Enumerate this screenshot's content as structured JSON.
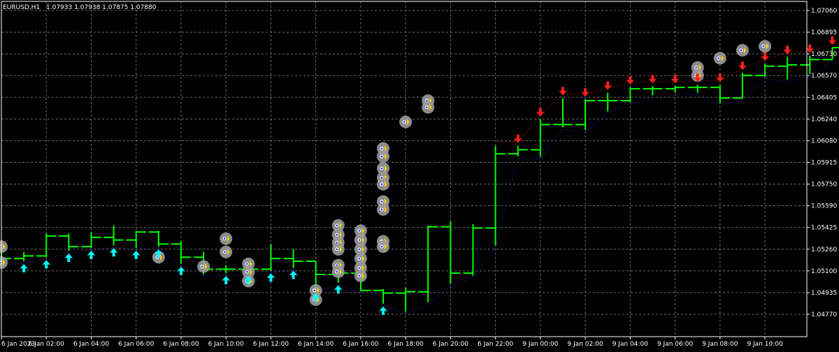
{
  "header": {
    "symbol_tf": "EURUSD,H1",
    "ohlc": "1.07933 1.07938 1.07875 1.07880"
  },
  "colors": {
    "background": "#000000",
    "grid": "#6d6d6d",
    "axis": "#ffffff",
    "bar": "#00ff00",
    "up_arrow": "#00ffff",
    "down_arrow": "#ff2020",
    "marker_circle": "#9a9a9a",
    "dot_blue": "#2233ff",
    "dot_red": "#ff2020"
  },
  "chart_data": {
    "type": "ohlc",
    "title": "EURUSD,H1  1.07933 1.07938 1.07875 1.07880",
    "ylim": [
      1.0477,
      1.0706
    ],
    "y_ticks": [
      "1.07060",
      "1.06895",
      "1.06730",
      "1.06570",
      "1.06405",
      "1.06240",
      "1.06080",
      "1.05915",
      "1.05750",
      "1.05590",
      "1.05425",
      "1.05260",
      "1.05100",
      "1.04935",
      "1.04770"
    ],
    "x_labels": [
      "6 Jan 2023",
      "6 Jan 02:00",
      "6 Jan 04:00",
      "6 Jan 06:00",
      "6 Jan 08:00",
      "6 Jan 10:00",
      "6 Jan 12:00",
      "6 Jan 14:00",
      "6 Jan 16:00",
      "6 Jan 18:00",
      "6 Jan 20:00",
      "6 Jan 22:00",
      "9 Jan 00:00",
      "9 Jan 02:00",
      "9 Jan 04:00",
      "9 Jan 06:00",
      "9 Jan 08:00",
      "9 Jan 10:00"
    ],
    "bars": [
      {
        "o": 1.0519,
        "h": 1.0526,
        "l": 1.0516,
        "c": 1.0519
      },
      {
        "o": 1.0519,
        "h": 1.0524,
        "l": 1.0517,
        "c": 1.0521
      },
      {
        "o": 1.0521,
        "h": 1.0538,
        "l": 1.052,
        "c": 1.0536
      },
      {
        "o": 1.0536,
        "h": 1.0538,
        "l": 1.0525,
        "c": 1.0528
      },
      {
        "o": 1.0528,
        "h": 1.0539,
        "l": 1.0527,
        "c": 1.0535
      },
      {
        "o": 1.0535,
        "h": 1.0544,
        "l": 1.0529,
        "c": 1.0533
      },
      {
        "o": 1.0533,
        "h": 1.054,
        "l": 1.0527,
        "c": 1.0539
      },
      {
        "o": 1.0539,
        "h": 1.054,
        "l": 1.0528,
        "c": 1.053
      },
      {
        "o": 1.053,
        "h": 1.0532,
        "l": 1.0515,
        "c": 1.052
      },
      {
        "o": 1.052,
        "h": 1.0524,
        "l": 1.0507,
        "c": 1.0511
      },
      {
        "o": 1.0511,
        "h": 1.0514,
        "l": 1.0508,
        "c": 1.0511
      },
      {
        "o": 1.0511,
        "h": 1.0514,
        "l": 1.0508,
        "c": 1.0511
      },
      {
        "o": 1.0511,
        "h": 1.053,
        "l": 1.051,
        "c": 1.0519
      },
      {
        "o": 1.0519,
        "h": 1.0526,
        "l": 1.0512,
        "c": 1.0517
      },
      {
        "o": 1.0517,
        "h": 1.0517,
        "l": 1.0495,
        "c": 1.0507
      },
      {
        "o": 1.0507,
        "h": 1.0507,
        "l": 1.0501,
        "c": 1.0508
      },
      {
        "o": 1.0508,
        "h": 1.0512,
        "l": 1.0495,
        "c": 1.0495
      },
      {
        "o": 1.0495,
        "h": 1.0496,
        "l": 1.0485,
        "c": 1.0493
      },
      {
        "o": 1.0493,
        "h": 1.0497,
        "l": 1.0479,
        "c": 1.0494
      },
      {
        "o": 1.0494,
        "h": 1.0544,
        "l": 1.0486,
        "c": 1.0543
      },
      {
        "o": 1.0543,
        "h": 1.0547,
        "l": 1.05,
        "c": 1.0508
      },
      {
        "o": 1.0508,
        "h": 1.0545,
        "l": 1.0506,
        "c": 1.0542
      },
      {
        "o": 1.0542,
        "h": 1.0604,
        "l": 1.0529,
        "c": 1.0598
      },
      {
        "o": 1.0598,
        "h": 1.0604,
        "l": 1.0596,
        "c": 1.0601
      },
      {
        "o": 1.0601,
        "h": 1.0624,
        "l": 1.0596,
        "c": 1.062
      },
      {
        "o": 1.062,
        "h": 1.064,
        "l": 1.0618,
        "c": 1.062
      },
      {
        "o": 1.062,
        "h": 1.0639,
        "l": 1.0616,
        "c": 1.0638
      },
      {
        "o": 1.0638,
        "h": 1.0644,
        "l": 1.063,
        "c": 1.0638
      },
      {
        "o": 1.0638,
        "h": 1.0648,
        "l": 1.0637,
        "c": 1.0647
      },
      {
        "o": 1.0647,
        "h": 1.0649,
        "l": 1.0642,
        "c": 1.0647
      },
      {
        "o": 1.0647,
        "h": 1.0649,
        "l": 1.0644,
        "c": 1.0648
      },
      {
        "o": 1.0648,
        "h": 1.065,
        "l": 1.0644,
        "c": 1.0648
      },
      {
        "o": 1.0648,
        "h": 1.065,
        "l": 1.0636,
        "c": 1.064
      },
      {
        "o": 1.064,
        "h": 1.0659,
        "l": 1.064,
        "c": 1.0657
      },
      {
        "o": 1.0657,
        "h": 1.0666,
        "l": 1.0656,
        "c": 1.0664
      },
      {
        "o": 1.0664,
        "h": 1.0671,
        "l": 1.0654,
        "c": 1.0665
      },
      {
        "o": 1.0665,
        "h": 1.0672,
        "l": 1.0658,
        "c": 1.0669
      },
      {
        "o": 1.0669,
        "h": 1.0678,
        "l": 1.0669,
        "c": 1.0678
      },
      {
        "o": 1.0678,
        "h": 1.0678,
        "l": 1.0677,
        "c": 1.0678
      },
      {
        "o": 1.0678,
        "h": 1.068,
        "l": 1.0669,
        "c": 1.0669
      },
      {
        "o": 1.0669,
        "h": 1.0677,
        "l": 1.0669,
        "c": 1.0676
      },
      {
        "o": 1.0676,
        "h": 1.0679,
        "l": 1.0674,
        "c": 1.0677
      },
      {
        "o": 1.0677,
        "h": 1.0683,
        "l": 1.0676,
        "c": 1.0677
      },
      {
        "o": 1.0677,
        "h": 1.0683,
        "l": 1.0676,
        "c": 1.0682
      },
      {
        "o": 1.0682,
        "h": 1.069,
        "l": 1.0675,
        "c": 1.0679
      },
      {
        "o": 1.0679,
        "h": 1.0695,
        "l": 1.0675,
        "c": 1.0693
      },
      {
        "o": 1.0693,
        "h": 1.0695,
        "l": 1.0673,
        "c": 1.0674
      },
      {
        "o": 1.0674,
        "h": 1.0696,
        "l": 1.0674,
        "c": 1.0691
      },
      {
        "o": 1.0691,
        "h": 1.06938,
        "l": 1.0673,
        "c": 1.0688
      }
    ],
    "up_arrows": [
      1,
      2,
      3,
      4,
      5,
      6,
      7,
      8,
      10,
      11,
      12,
      13,
      14,
      15,
      17
    ],
    "down_arrows": [
      23,
      24,
      25,
      26,
      27,
      28,
      29,
      30,
      31,
      32,
      33,
      34,
      35,
      36,
      37,
      38,
      39,
      40,
      41,
      42,
      43,
      44,
      45,
      46,
      47,
      48
    ],
    "markers": [
      {
        "i": 0,
        "p": [
          1.0528,
          1.0516
        ]
      },
      {
        "i": 7,
        "p": [
          1.052
        ]
      },
      {
        "i": 9,
        "p": [
          1.0513
        ]
      },
      {
        "i": 10,
        "p": [
          1.0534,
          1.0524
        ]
      },
      {
        "i": 11,
        "p": [
          1.0515,
          1.0509,
          1.0502
        ]
      },
      {
        "i": 14,
        "p": [
          1.0495,
          1.0488
        ]
      },
      {
        "i": 15,
        "p": [
          1.0544,
          1.0537,
          1.0531,
          1.0526,
          1.0514,
          1.0509
        ]
      },
      {
        "i": 16,
        "p": [
          1.054,
          1.0533,
          1.0526,
          1.0519,
          1.0512,
          1.0506
        ]
      },
      {
        "i": 17,
        "p": [
          1.0602,
          1.0596,
          1.0587,
          1.058,
          1.0575,
          1.0562,
          1.0556,
          1.0532,
          1.0528
        ]
      },
      {
        "i": 18,
        "p": [
          1.0622
        ]
      },
      {
        "i": 19,
        "p": [
          1.0638,
          1.0633
        ]
      },
      {
        "i": 31,
        "p": [
          1.0663,
          1.0657
        ]
      },
      {
        "i": 32,
        "p": [
          1.067
        ]
      },
      {
        "i": 33,
        "p": [
          1.0676
        ]
      },
      {
        "i": 34,
        "p": [
          1.0679
        ]
      },
      {
        "i": 38,
        "p": [
          1.0683
        ]
      },
      {
        "i": 40,
        "p": [
          1.0693,
          1.0674
        ]
      },
      {
        "i": 41,
        "p": [
          1.0699,
          1.0693,
          1.0679
        ]
      },
      {
        "i": 43,
        "p": [
          1.068,
          1.0674,
          1.0668,
          1.0662
        ]
      }
    ]
  }
}
